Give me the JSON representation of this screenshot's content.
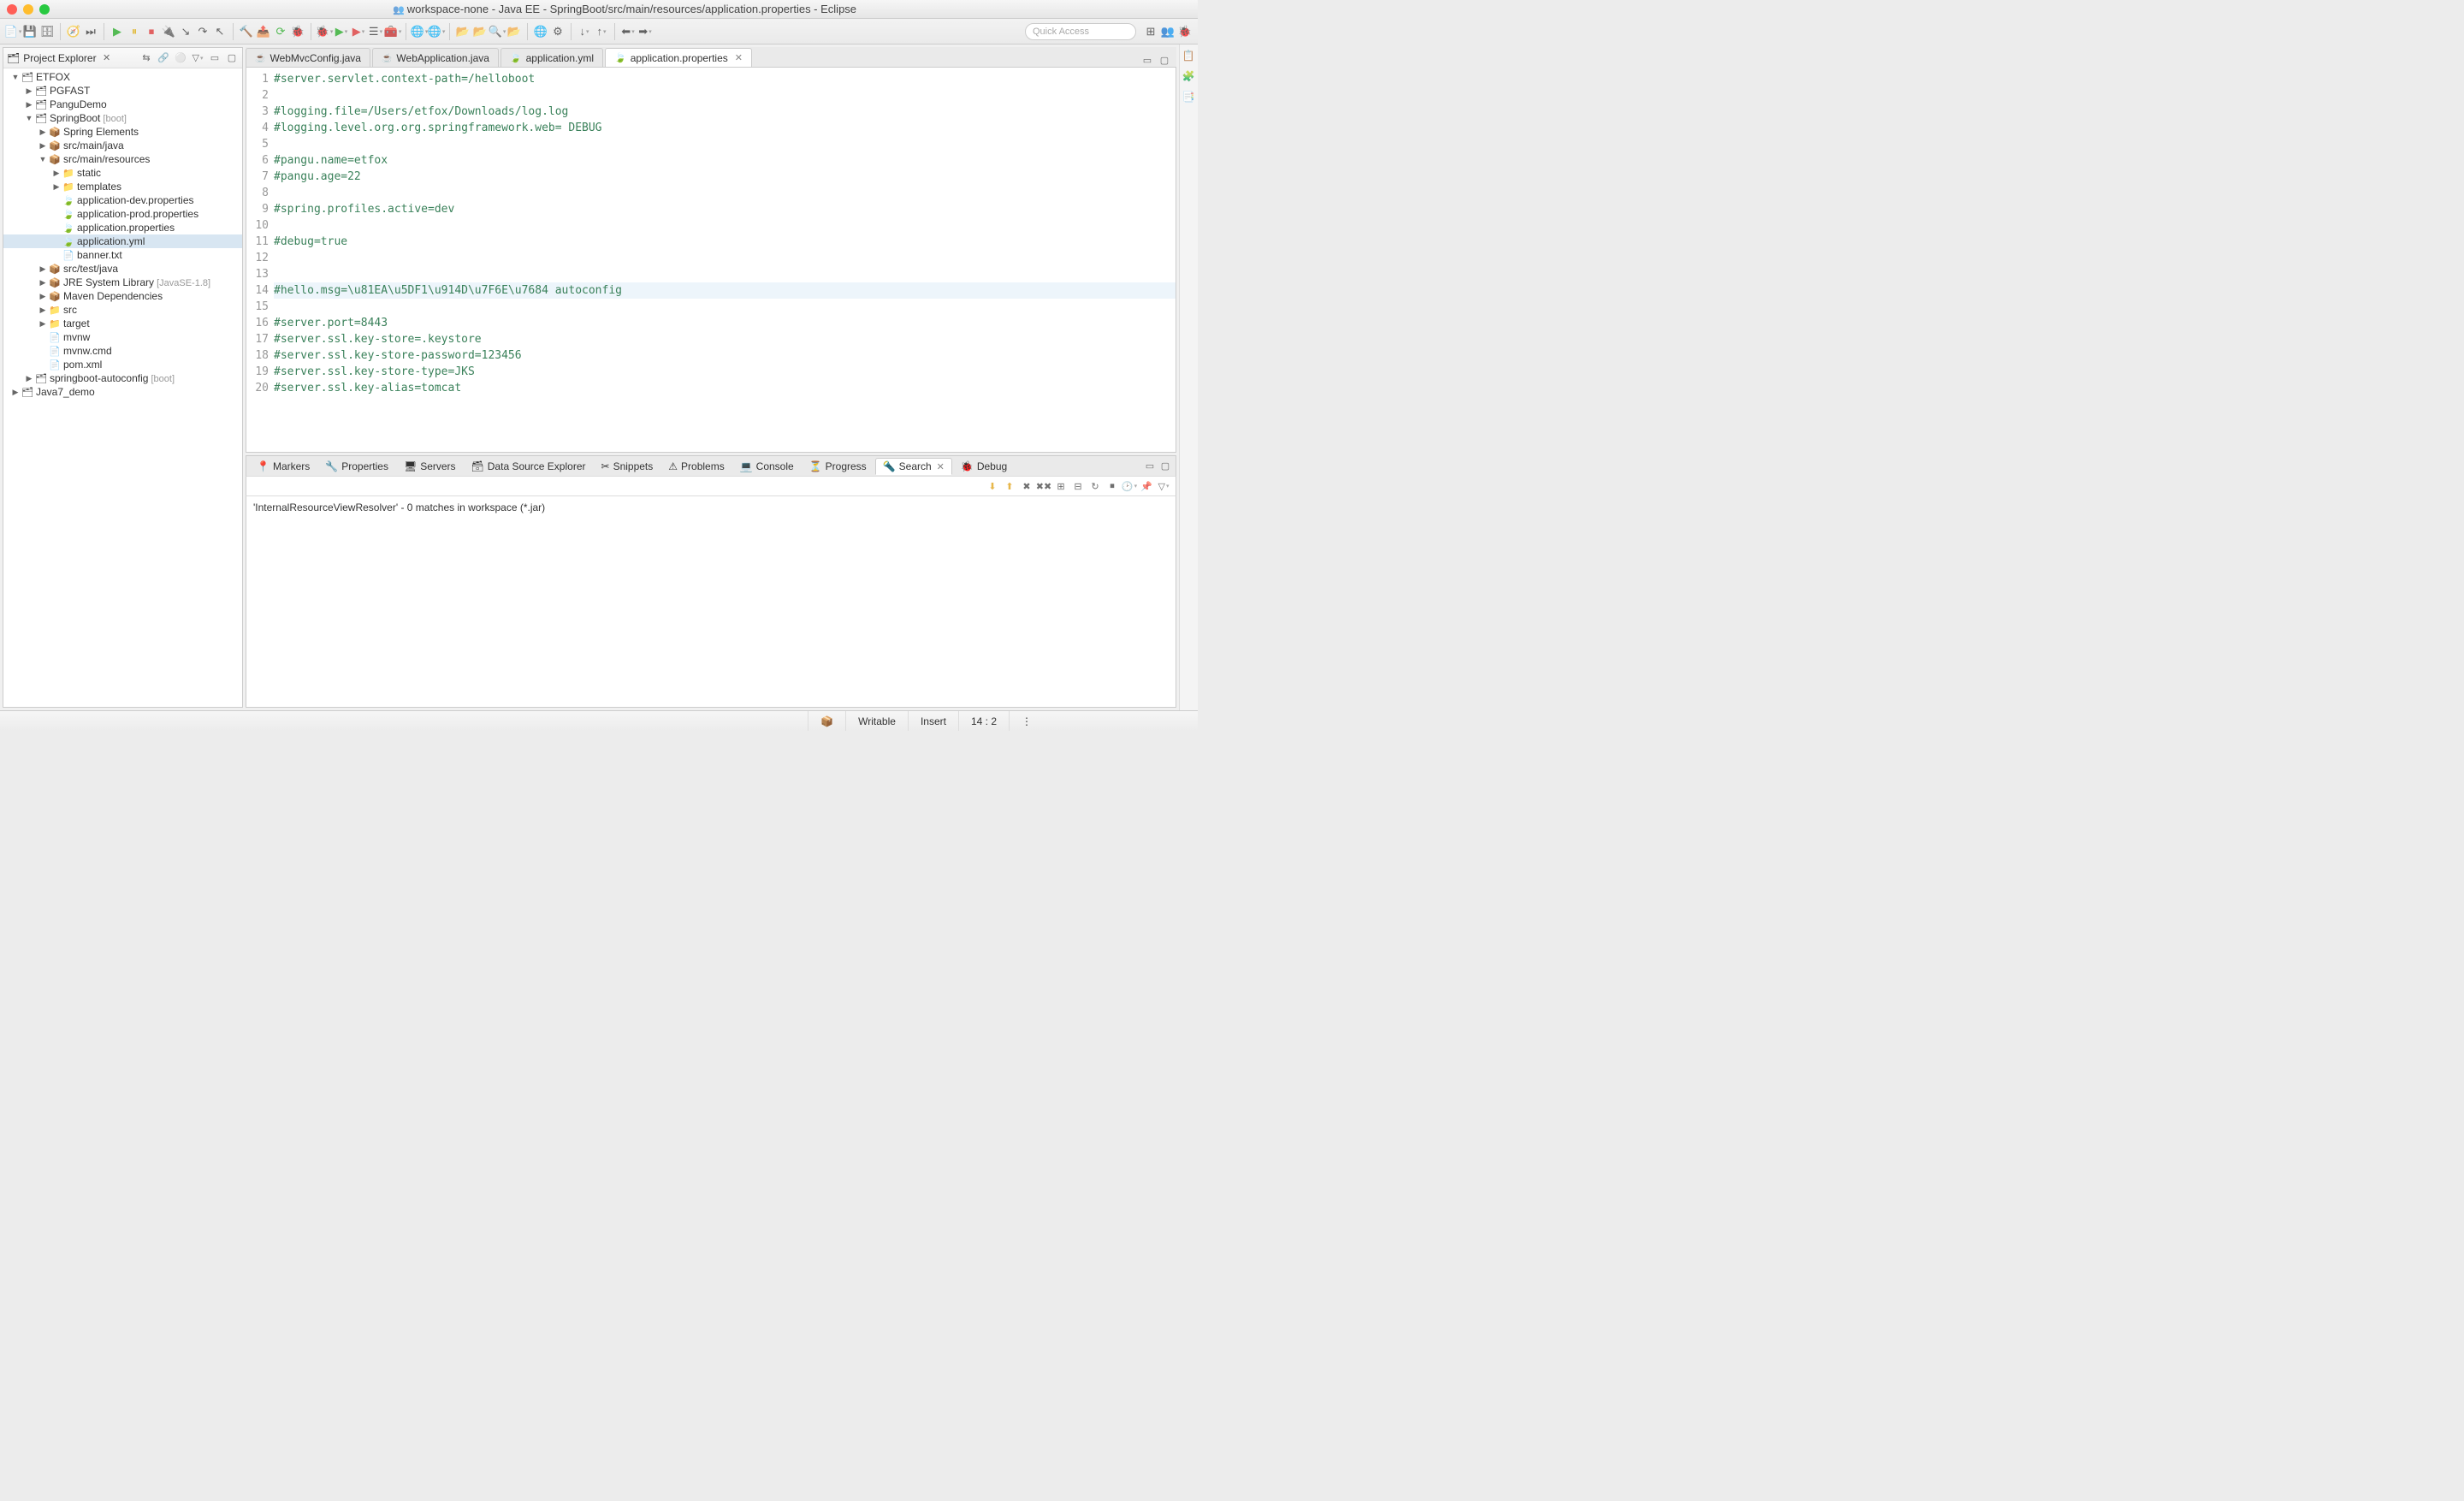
{
  "window": {
    "title": "workspace-none - Java EE - SpringBoot/src/main/resources/application.properties - Eclipse"
  },
  "quick_access": {
    "placeholder": "Quick Access"
  },
  "explorer": {
    "title": "Project Explorer",
    "tree": [
      {
        "d": 0,
        "tw": "▼",
        "icon": "i-proj",
        "label": "ETFOX"
      },
      {
        "d": 1,
        "tw": "▶",
        "icon": "i-proj",
        "label": "PGFAST"
      },
      {
        "d": 1,
        "tw": "▶",
        "icon": "i-proj",
        "label": "PanguDemo"
      },
      {
        "d": 1,
        "tw": "▼",
        "icon": "i-proj",
        "label": "SpringBoot",
        "decor": " [boot]"
      },
      {
        "d": 2,
        "tw": "▶",
        "icon": "i-pkg",
        "label": "Spring Elements"
      },
      {
        "d": 2,
        "tw": "▶",
        "icon": "i-pkg",
        "label": "src/main/java"
      },
      {
        "d": 2,
        "tw": "▼",
        "icon": "i-pkg",
        "label": "src/main/resources"
      },
      {
        "d": 3,
        "tw": "▶",
        "icon": "i-folder",
        "label": "static"
      },
      {
        "d": 3,
        "tw": "▶",
        "icon": "i-folder",
        "label": "templates"
      },
      {
        "d": 3,
        "tw": "",
        "icon": "i-prop",
        "label": "application-dev.properties"
      },
      {
        "d": 3,
        "tw": "",
        "icon": "i-prop",
        "label": "application-prod.properties"
      },
      {
        "d": 3,
        "tw": "",
        "icon": "i-prop",
        "label": "application.properties"
      },
      {
        "d": 3,
        "tw": "",
        "icon": "i-prop",
        "label": "application.yml",
        "selected": true
      },
      {
        "d": 3,
        "tw": "",
        "icon": "i-file",
        "label": "banner.txt"
      },
      {
        "d": 2,
        "tw": "▶",
        "icon": "i-pkg",
        "label": "src/test/java"
      },
      {
        "d": 2,
        "tw": "▶",
        "icon": "i-pkg",
        "label": "JRE System Library",
        "decor": " [JavaSE-1.8]"
      },
      {
        "d": 2,
        "tw": "▶",
        "icon": "i-pkg",
        "label": "Maven Dependencies"
      },
      {
        "d": 2,
        "tw": "▶",
        "icon": "i-folder",
        "label": "src"
      },
      {
        "d": 2,
        "tw": "▶",
        "icon": "i-folder",
        "label": "target"
      },
      {
        "d": 2,
        "tw": "",
        "icon": "i-file",
        "label": "mvnw"
      },
      {
        "d": 2,
        "tw": "",
        "icon": "i-file",
        "label": "mvnw.cmd"
      },
      {
        "d": 2,
        "tw": "",
        "icon": "i-file",
        "label": "pom.xml"
      },
      {
        "d": 1,
        "tw": "▶",
        "icon": "i-proj",
        "label": "springboot-autoconfig",
        "decor": " [boot]"
      },
      {
        "d": 0,
        "tw": "▶",
        "icon": "i-proj",
        "label": "Java7_demo"
      }
    ]
  },
  "editor": {
    "tabs": [
      {
        "icon": "i-java",
        "label": "WebMvcConfig.java"
      },
      {
        "icon": "i-java",
        "label": "WebApplication.java"
      },
      {
        "icon": "i-prop",
        "label": "application.yml"
      },
      {
        "icon": "i-prop",
        "label": "application.properties",
        "active": true,
        "closeable": true
      }
    ],
    "lines": [
      {
        "n": 1,
        "text": "#server.servlet.context-path=/helloboot"
      },
      {
        "n": 2,
        "text": ""
      },
      {
        "n": 3,
        "text": "#logging.file=/Users/etfox/Downloads/log.log"
      },
      {
        "n": 4,
        "text": "#logging.level.org.org.springframework.web= DEBUG"
      },
      {
        "n": 5,
        "text": ""
      },
      {
        "n": 6,
        "text": "#pangu.name=etfox"
      },
      {
        "n": 7,
        "text": "#pangu.age=22"
      },
      {
        "n": 8,
        "text": ""
      },
      {
        "n": 9,
        "text": "#spring.profiles.active=dev"
      },
      {
        "n": 10,
        "text": ""
      },
      {
        "n": 11,
        "text": "#debug=true"
      },
      {
        "n": 12,
        "text": ""
      },
      {
        "n": 13,
        "text": ""
      },
      {
        "n": 14,
        "text": "#hello.msg=\\u81EA\\u5DF1\\u914D\\u7F6E\\u7684 autoconfig",
        "hl": true
      },
      {
        "n": 15,
        "text": ""
      },
      {
        "n": 16,
        "text": "#server.port=8443"
      },
      {
        "n": 17,
        "text": "#server.ssl.key-store=.keystore"
      },
      {
        "n": 18,
        "text": "#server.ssl.key-store-password=123456"
      },
      {
        "n": 19,
        "text": "#server.ssl.key-store-type=JKS"
      },
      {
        "n": 20,
        "text": "#server.ssl.key-alias=tomcat"
      }
    ]
  },
  "bottom": {
    "tabs": [
      {
        "label": "Markers"
      },
      {
        "label": "Properties"
      },
      {
        "label": "Servers"
      },
      {
        "label": "Data Source Explorer"
      },
      {
        "label": "Snippets"
      },
      {
        "label": "Problems"
      },
      {
        "label": "Console"
      },
      {
        "label": "Progress"
      },
      {
        "label": "Search",
        "active": true,
        "closeable": true
      },
      {
        "label": "Debug"
      }
    ],
    "search_summary": "'InternalResourceViewResolver' - 0 matches in workspace (*.jar)"
  },
  "status": {
    "writable": "Writable",
    "insert": "Insert",
    "cursor": "14 : 2"
  }
}
